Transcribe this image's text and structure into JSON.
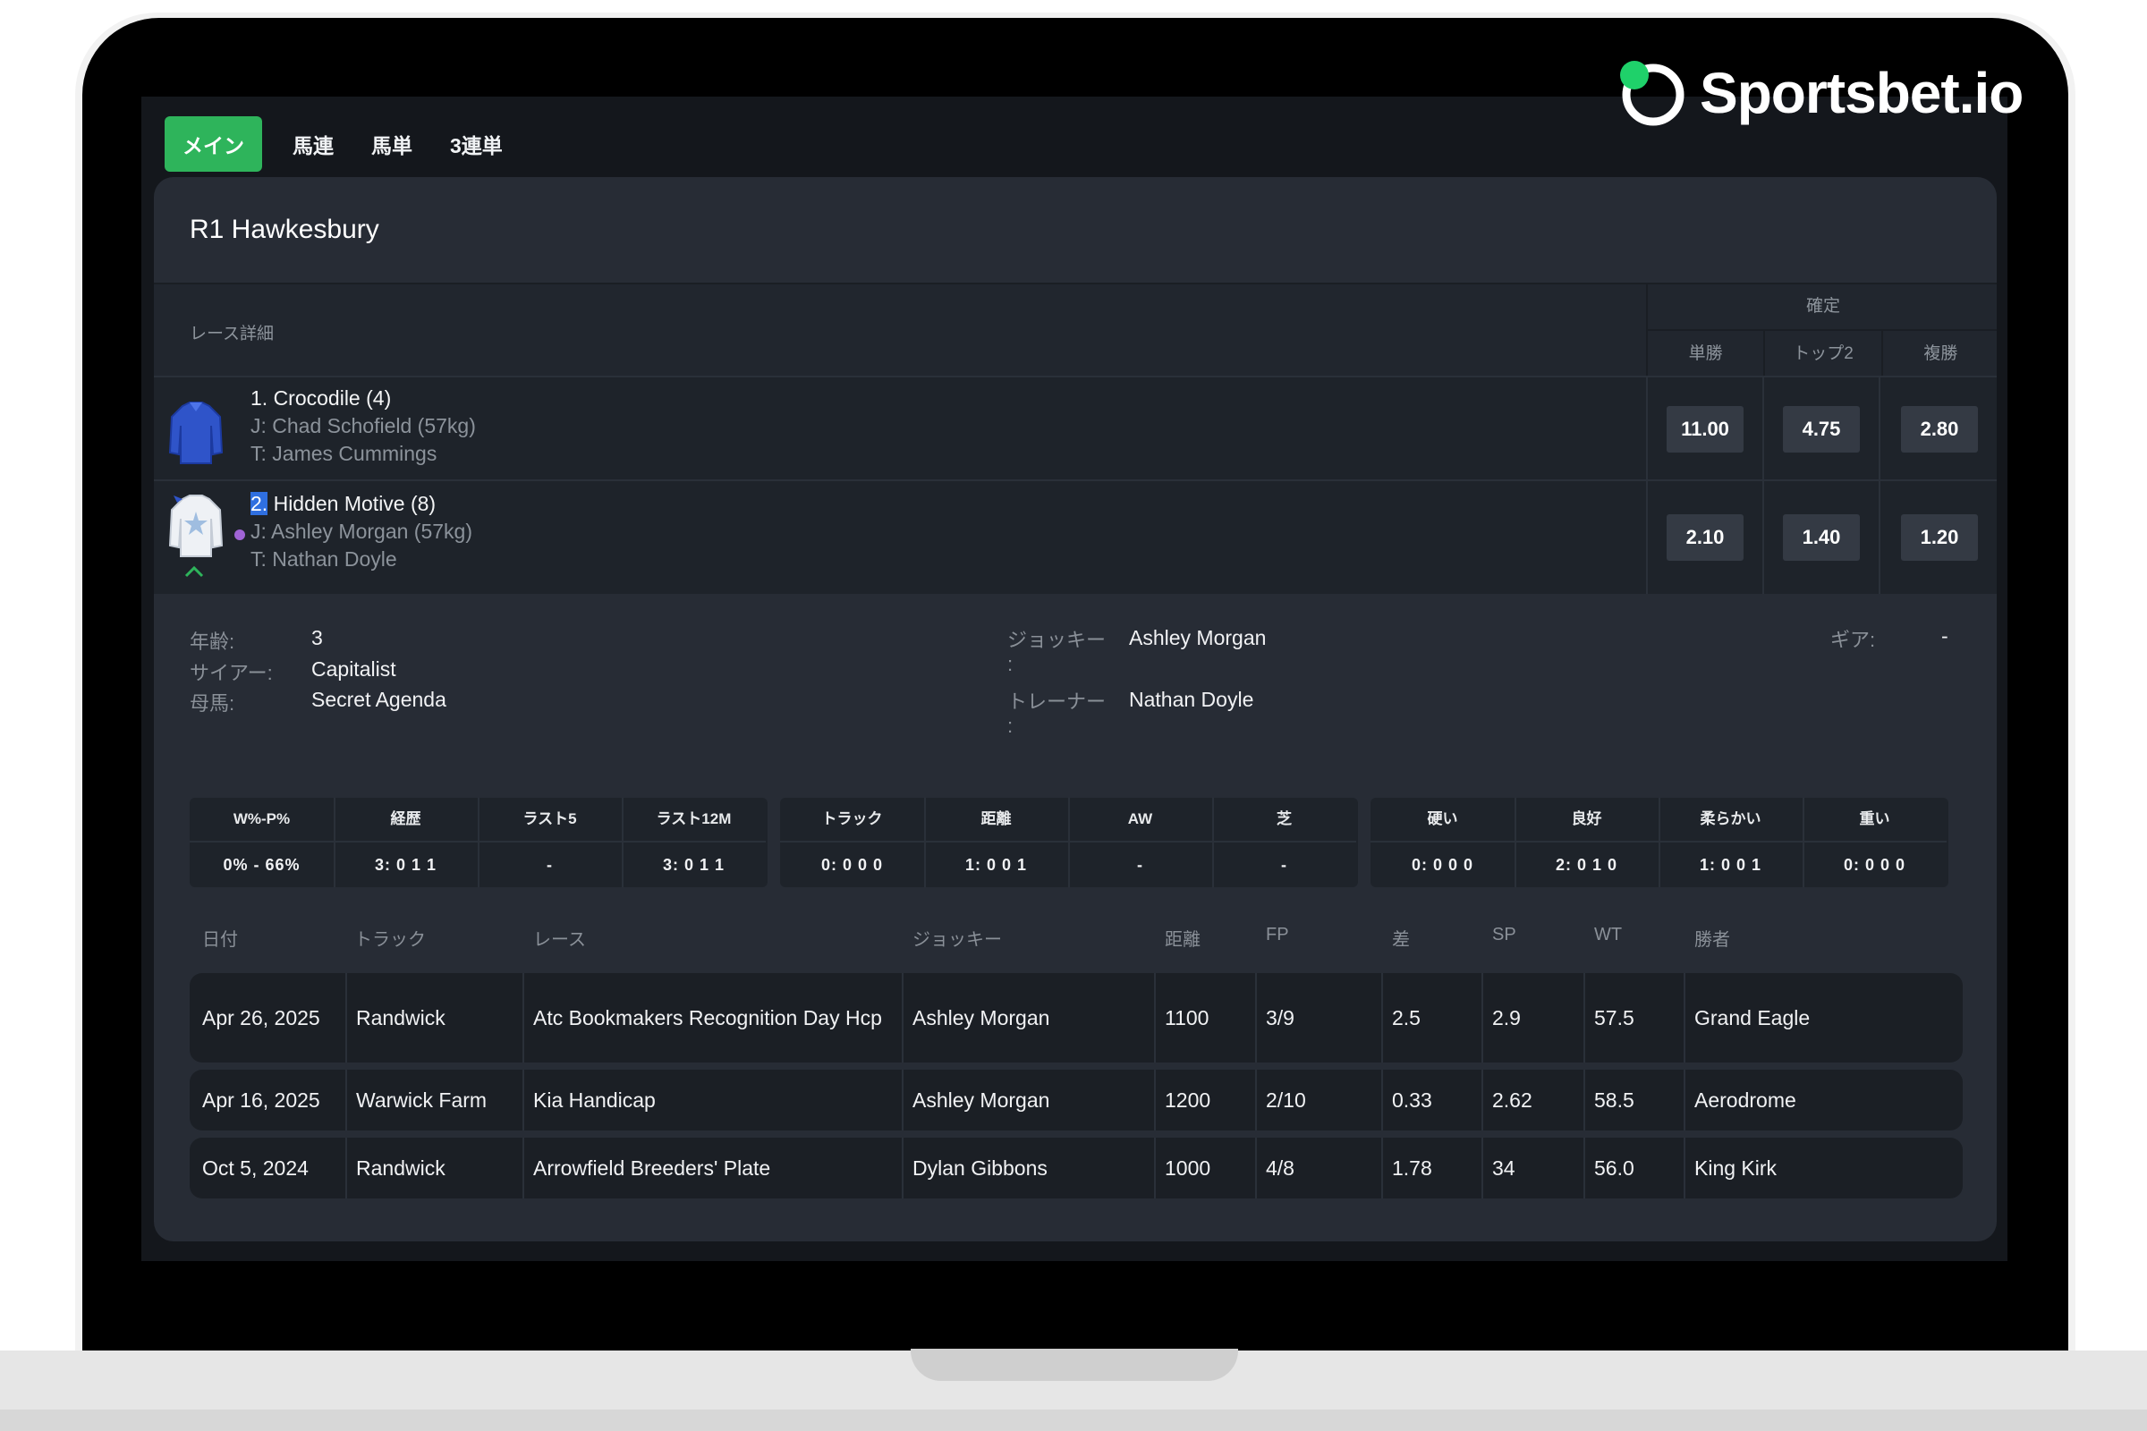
{
  "brand": {
    "name": "Sportsbet.io",
    "accent": "#2eb45b"
  },
  "tabs": [
    "メイン",
    "馬連",
    "馬単",
    "3連単"
  ],
  "race": {
    "title": "R1 Hawkesbury",
    "details_label": "レース詳細",
    "odds_group_label": "確定",
    "odds_headers": [
      "単勝",
      "トップ2",
      "複勝"
    ]
  },
  "runners": [
    {
      "name": "1. Crocodile (4)",
      "jockey": "J: Chad Schofield (57kg)",
      "trainer": "T: James Cummings",
      "odds": [
        "11.00",
        "4.75",
        "2.80"
      ]
    },
    {
      "num": "2.",
      "name": " Hidden Motive (8)",
      "jockey": "J: Ashley Morgan (57kg)",
      "trainer": "T: Nathan Doyle",
      "odds": [
        "2.10",
        "1.40",
        "1.20"
      ]
    }
  ],
  "detail": {
    "age_label": "年齢:",
    "age": "3",
    "sire_label": "サイアー:",
    "sire": "Capitalist",
    "dam_label": "母馬:",
    "dam": "Secret Agenda",
    "jockey_label": "ジョッキー",
    "jockey_colon": ":",
    "jockey": "Ashley Morgan",
    "trainer_label": "トレーナー",
    "trainer_colon": ":",
    "trainer": "Nathan Doyle",
    "gear_label": "ギア:",
    "gear": "-"
  },
  "stats": {
    "group1": [
      [
        "W%-P%",
        "0% - 66%"
      ],
      [
        "経歴",
        "3: 0 1 1"
      ],
      [
        "ラスト5",
        "-"
      ],
      [
        "ラスト12M",
        "3: 0 1 1"
      ]
    ],
    "group2": [
      [
        "トラック",
        "0: 0 0 0"
      ],
      [
        "距離",
        "1: 0 0 1"
      ],
      [
        "AW",
        "-"
      ],
      [
        "芝",
        "-"
      ]
    ],
    "group3": [
      [
        "硬い",
        "0: 0 0 0"
      ],
      [
        "良好",
        "2: 0 1 0"
      ],
      [
        "柔らかい",
        "1: 0 0 1"
      ],
      [
        "重い",
        "0: 0 0 0"
      ]
    ]
  },
  "history": {
    "headers": [
      "日付",
      "トラック",
      "レース",
      "ジョッキー",
      "距離",
      "FP",
      "差",
      "SP",
      "WT",
      "勝者"
    ],
    "rows": [
      [
        "Apr 26, 2025",
        "Randwick",
        "Atc Bookmakers Recognition Day Hcp",
        "Ashley Morgan",
        "1100",
        "3/9",
        "2.5",
        "2.9",
        "57.5",
        "Grand Eagle"
      ],
      [
        "Apr 16, 2025",
        "Warwick Farm",
        "Kia Handicap",
        "Ashley Morgan",
        "1200",
        "2/10",
        "0.33",
        "2.62",
        "58.5",
        "Aerodrome"
      ],
      [
        "Oct 5, 2024",
        "Randwick",
        "Arrowfield Breeders' Plate",
        "Dylan Gibbons",
        "1000",
        "4/8",
        "1.78",
        "34",
        "56.0",
        "King Kirk"
      ]
    ]
  }
}
